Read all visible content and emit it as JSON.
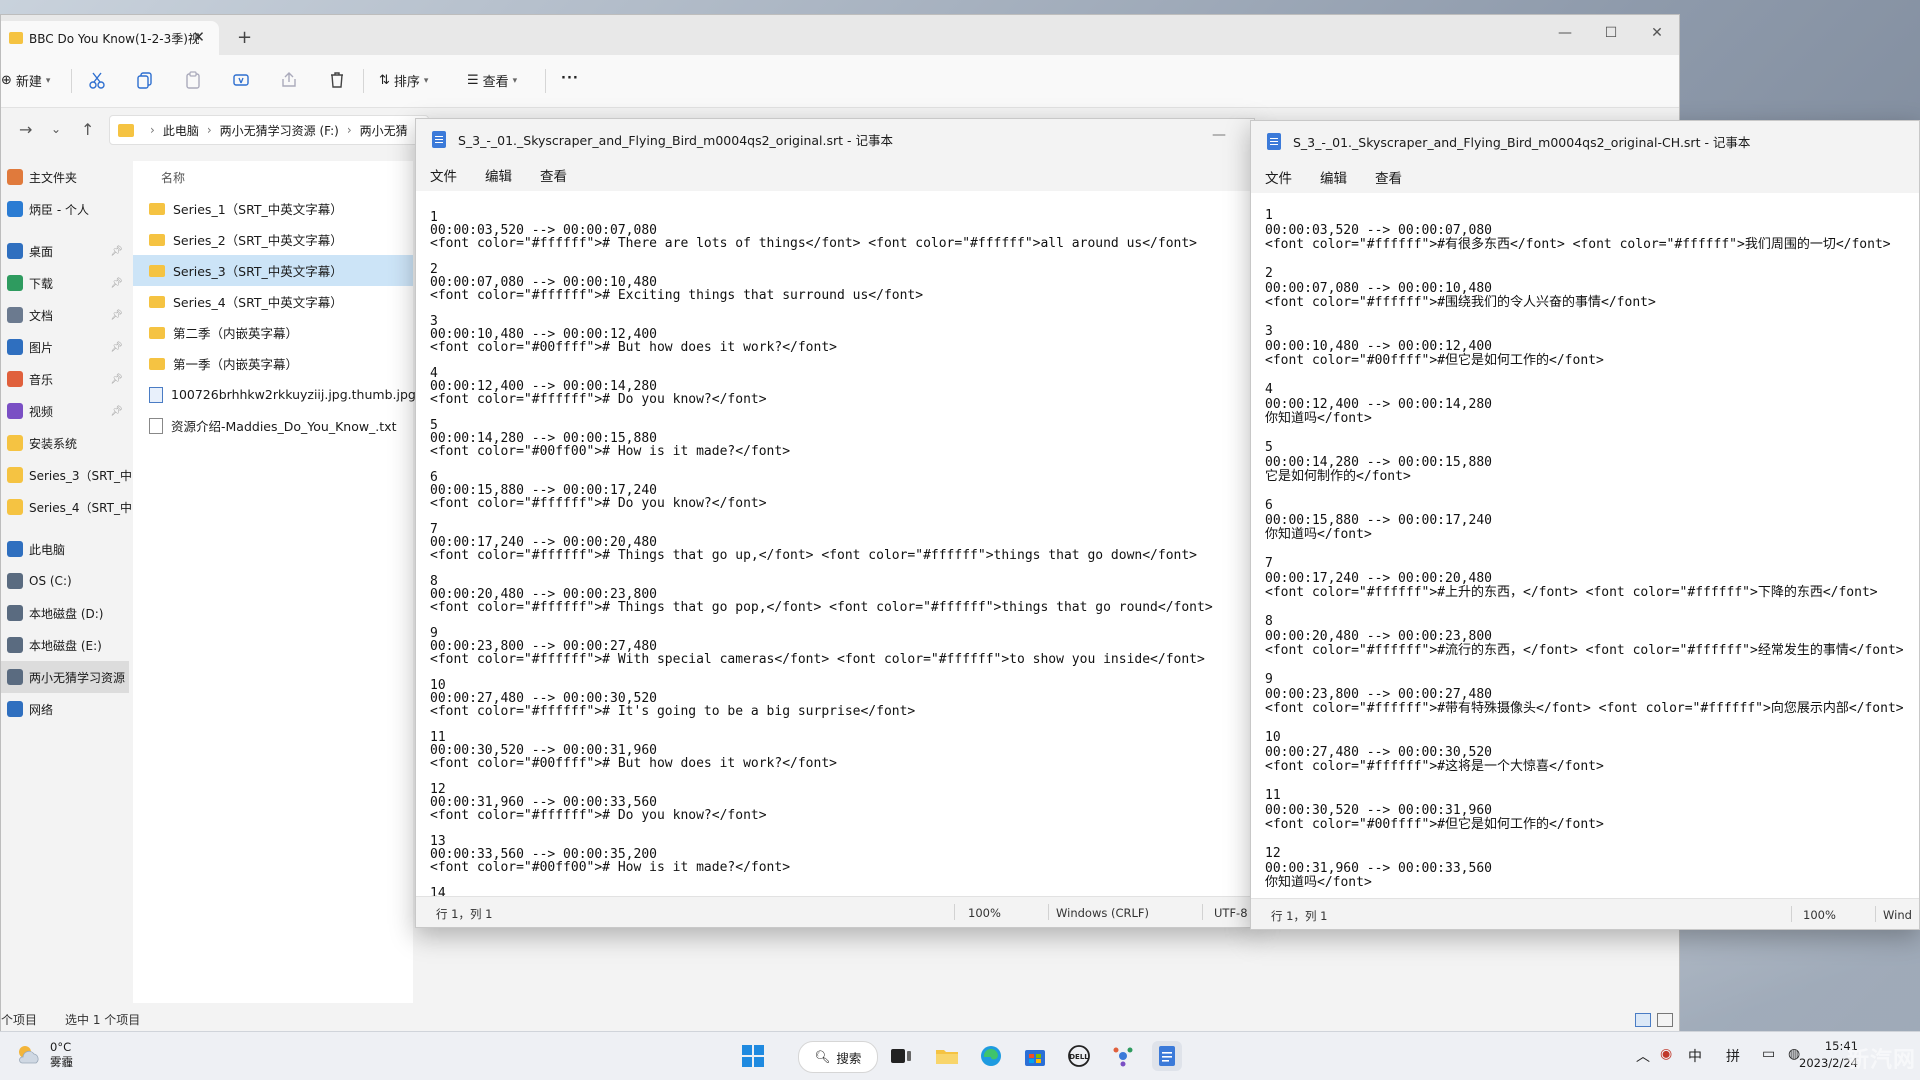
{
  "explorer": {
    "tab_title": "BBC Do You Know(1-2-3季)视",
    "toolbar": {
      "new_label": "新建",
      "sort_label": "排序",
      "view_label": "查看",
      "more_label": "···"
    },
    "breadcrumb": [
      "此电脑",
      "两小无猜学习资源 (F:)",
      "两小无猜"
    ],
    "nav_items": [
      {
        "label": "主文件夹",
        "icon": "home-icon",
        "color": "#e07a3c"
      },
      {
        "label": "炳臣 - 个人",
        "icon": "onedrive-icon",
        "color": "#2b7cd3"
      },
      {
        "label": "桌面",
        "icon": "desktop-icon",
        "color": "#2f6fbf",
        "pinned": true
      },
      {
        "label": "下载",
        "icon": "download-icon",
        "color": "#2e9b5f",
        "pinned": true
      },
      {
        "label": "文档",
        "icon": "documents-icon",
        "color": "#6b7a8f",
        "pinned": true
      },
      {
        "label": "图片",
        "icon": "pictures-icon",
        "color": "#2f6fbf",
        "pinned": true
      },
      {
        "label": "音乐",
        "icon": "music-icon",
        "color": "#e0603c",
        "pinned": true
      },
      {
        "label": "视频",
        "icon": "videos-icon",
        "color": "#7a4fc4",
        "pinned": true
      },
      {
        "label": "安装系统",
        "icon": "folder-icon",
        "color": "#f5c342"
      },
      {
        "label": "Series_3（SRT_中",
        "icon": "folder-icon",
        "color": "#f5c342"
      },
      {
        "label": "Series_4（SRT_中",
        "icon": "folder-icon",
        "color": "#f5c342"
      },
      {
        "label": "此电脑",
        "icon": "pc-icon",
        "color": "#2f6fbf"
      },
      {
        "label": "OS (C:)",
        "icon": "drive-icon",
        "color": "#5a6b80"
      },
      {
        "label": "本地磁盘 (D:)",
        "icon": "drive-icon",
        "color": "#5a6b80"
      },
      {
        "label": "本地磁盘 (E:)",
        "icon": "drive-icon",
        "color": "#5a6b80"
      },
      {
        "label": "两小无猜学习资源",
        "icon": "drive-icon",
        "color": "#5a6b80",
        "selected": true
      },
      {
        "label": "网络",
        "icon": "network-icon",
        "color": "#2f6fbf"
      }
    ],
    "column_name": "名称",
    "files": [
      {
        "name": "Series_1（SRT_中英文字幕）",
        "type": "folder"
      },
      {
        "name": "Series_2（SRT_中英文字幕）",
        "type": "folder"
      },
      {
        "name": "Series_3（SRT_中英文字幕）",
        "type": "folder",
        "selected": true
      },
      {
        "name": "Series_4（SRT_中英文字幕）",
        "type": "folder"
      },
      {
        "name": "第二季（内嵌英字幕）",
        "type": "folder"
      },
      {
        "name": "第一季（内嵌英字幕）",
        "type": "folder"
      },
      {
        "name": "100726brhhkw2rkkuyziij.jpg.thumb.jpg",
        "type": "image"
      },
      {
        "name": "资源介绍-Maddies_Do_You_Know_.txt",
        "type": "text"
      }
    ],
    "status_count": "个项目",
    "status_selected": "选中 1 个项目"
  },
  "notepad_left": {
    "title": "S_3_-_01._Skyscraper_and_Flying_Bird_m0004qs2_original.srt - 记事本",
    "menu": [
      "文件",
      "编辑",
      "查看"
    ],
    "content": "1\n00:00:03,520 --> 00:00:07,080\n<font color=\"#ffffff\"># There are lots of things</font> <font color=\"#ffffff\">all around us</font>\n\n2\n00:00:07,080 --> 00:00:10,480\n<font color=\"#ffffff\"># Exciting things that surround us</font>\n\n3\n00:00:10,480 --> 00:00:12,400\n<font color=\"#00ffff\"># But how does it work?</font>\n\n4\n00:00:12,400 --> 00:00:14,280\n<font color=\"#ffffff\"># Do you know?</font>\n\n5\n00:00:14,280 --> 00:00:15,880\n<font color=\"#00ff00\"># How is it made?</font>\n\n6\n00:00:15,880 --> 00:00:17,240\n<font color=\"#ffffff\"># Do you know?</font>\n\n7\n00:00:17,240 --> 00:00:20,480\n<font color=\"#ffffff\"># Things that go up,</font> <font color=\"#ffffff\">things that go down</font>\n\n8\n00:00:20,480 --> 00:00:23,800\n<font color=\"#ffffff\"># Things that go pop,</font> <font color=\"#ffffff\">things that go round</font>\n\n9\n00:00:23,800 --> 00:00:27,480\n<font color=\"#ffffff\"># With special cameras</font> <font color=\"#ffffff\">to show you inside</font>\n\n10\n00:00:27,480 --> 00:00:30,520\n<font color=\"#ffffff\"># It's going to be a big surprise</font>\n\n11\n00:00:30,520 --> 00:00:31,960\n<font color=\"#00ffff\"># But how does it work?</font>\n\n12\n00:00:31,960 --> 00:00:33,560\n<font color=\"#ffffff\"># Do you know?</font>\n\n13\n00:00:33,560 --> 00:00:35,200\n<font color=\"#00ff00\"># How is it made?</font>\n\n14",
    "status": {
      "position": "行 1，列 1",
      "zoom": "100%",
      "line_ending": "Windows (CRLF)",
      "encoding": "UTF-8"
    }
  },
  "notepad_right": {
    "title": "S_3_-_01._Skyscraper_and_Flying_Bird_m0004qs2_original-CH.srt - 记事本",
    "menu": [
      "文件",
      "编辑",
      "查看"
    ],
    "content": "1\n00:00:03,520 --> 00:00:07,080\n<font color=\"#ffffff\">#有很多东西</font> <font color=\"#ffffff\">我们周围的一切</font>\n\n2\n00:00:07,080 --> 00:00:10,480\n<font color=\"#ffffff\">#围绕我们的令人兴奋的事情</font>\n\n3\n00:00:10,480 --> 00:00:12,400\n<font color=\"#00ffff\">#但它是如何工作的</font>\n\n4\n00:00:12,400 --> 00:00:14,280\n你知道吗</font>\n\n5\n00:00:14,280 --> 00:00:15,880\n它是如何制作的</font>\n\n6\n00:00:15,880 --> 00:00:17,240\n你知道吗</font>\n\n7\n00:00:17,240 --> 00:00:20,480\n<font color=\"#ffffff\">#上升的东西，</font> <font color=\"#ffffff\">下降的东西</font>\n\n8\n00:00:20,480 --> 00:00:23,800\n<font color=\"#ffffff\">#流行的东西，</font> <font color=\"#ffffff\">经常发生的事情</font>\n\n9\n00:00:23,800 --> 00:00:27,480\n<font color=\"#ffffff\">#带有特殊摄像头</font> <font color=\"#ffffff\">向您展示内部</font>\n\n10\n00:00:27,480 --> 00:00:30,520\n<font color=\"#ffffff\">#这将是一个大惊喜</font>\n\n11\n00:00:30,520 --> 00:00:31,960\n<font color=\"#00ffff\">#但它是如何工作的</font>\n\n12\n00:00:31,960 --> 00:00:33,560\n你知道吗</font>",
    "status": {
      "position": "行 1，列 1",
      "zoom": "100%",
      "line_ending": "Wind"
    }
  },
  "taskbar": {
    "weather_temp": "0°C",
    "weather_desc": "雾霾",
    "search_label": "搜索",
    "ime_lang": "中",
    "ime_mode": "拼",
    "clock_time": "15:41",
    "clock_date": "2023/2/24",
    "watermark": "新汽网"
  }
}
